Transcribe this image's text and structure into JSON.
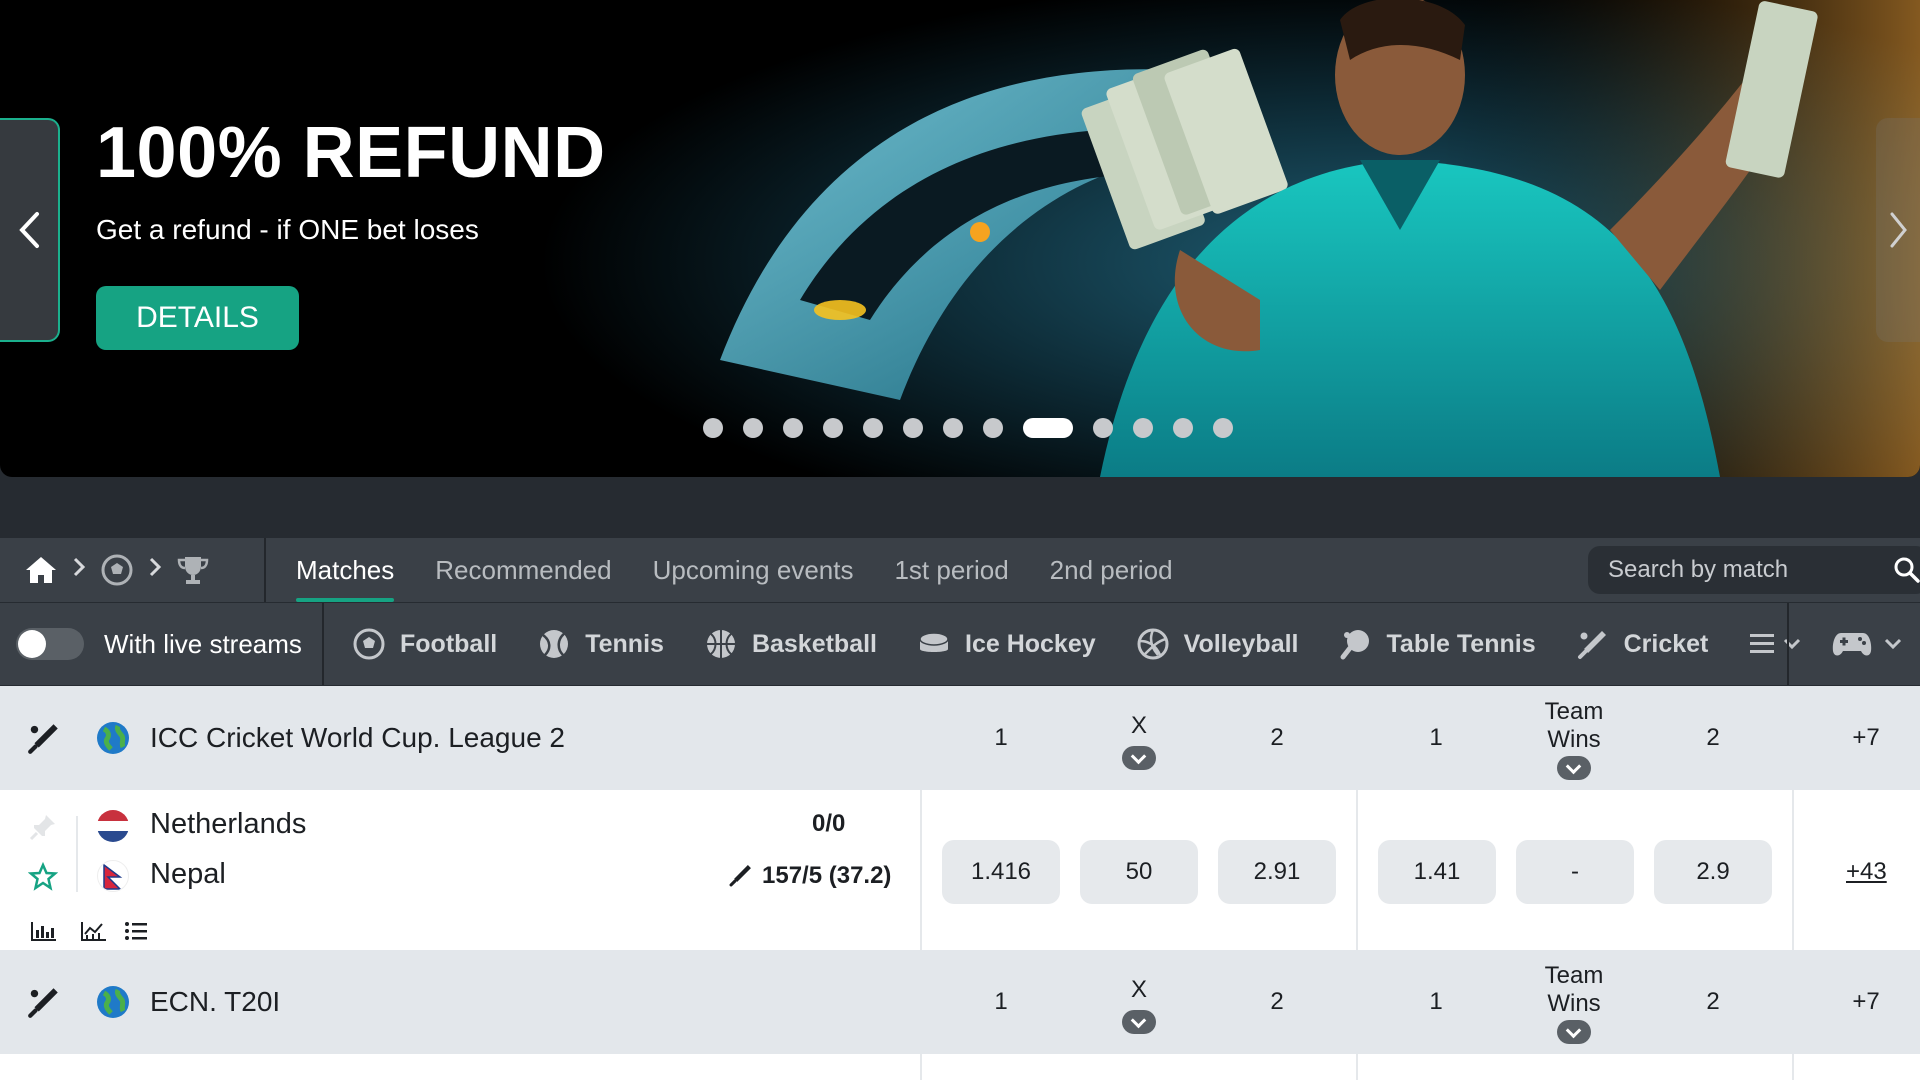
{
  "banner": {
    "title": "100% REFUND",
    "subtitle": "Get a refund - if ONE bet loses",
    "cta_label": "DETAILS",
    "dots_total": 13,
    "active_dot_index": 8
  },
  "nav": {
    "tabs": [
      {
        "label": "Matches",
        "active": true
      },
      {
        "label": "Recommended",
        "active": false
      },
      {
        "label": "Upcoming events",
        "active": false
      },
      {
        "label": "1st period",
        "active": false
      },
      {
        "label": "2nd period",
        "active": false
      }
    ],
    "search_placeholder": "Search by match"
  },
  "filters": {
    "live_streams_label": "With live streams",
    "live_streams_on": false,
    "sports": [
      {
        "label": "Football",
        "icon": "football-icon"
      },
      {
        "label": "Tennis",
        "icon": "tennis-icon"
      },
      {
        "label": "Basketball",
        "icon": "basketball-icon"
      },
      {
        "label": "Ice Hockey",
        "icon": "ice-hockey-icon"
      },
      {
        "label": "Volleyball",
        "icon": "volleyball-icon"
      },
      {
        "label": "Table Tennis",
        "icon": "table-tennis-icon"
      },
      {
        "label": "Cricket",
        "icon": "cricket-icon"
      }
    ]
  },
  "league1": {
    "name": "ICC Cricket World Cup. League 2",
    "h1": "1",
    "hx": "X",
    "h2": "2",
    "h3": "1",
    "h4": "Team Wins",
    "h5": "2",
    "more": "+7"
  },
  "match1": {
    "team1": "Netherlands",
    "team2": "Nepal",
    "score1": "0/0",
    "score2": "157/5 (37.2)",
    "odds": [
      "1.416",
      "50",
      "2.91",
      "1.41",
      "-",
      "2.9"
    ],
    "more": "+43"
  },
  "league2": {
    "name": "ECN. T20I",
    "h1": "1",
    "hx": "X",
    "h2": "2",
    "h3": "1",
    "h4": "Team Wins",
    "h5": "2",
    "more": "+7"
  },
  "colors": {
    "accent": "#16a383",
    "nav_bg": "#3a4047",
    "league_bg": "#e3e7eb",
    "odd_bg": "#e6e9ec"
  }
}
